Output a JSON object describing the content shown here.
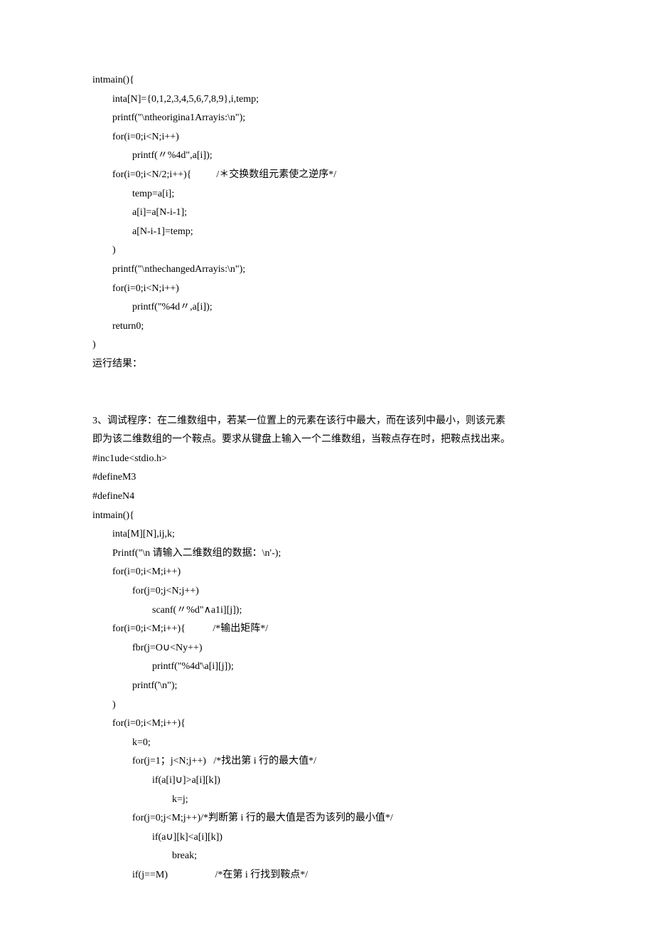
{
  "lines": [
    "intmain(){",
    "        inta[N]={0,1,2,3,4,5,6,7,8,9},i,temp;",
    "        printf(\"\\ntheorigina1Arrayis:\\n\");",
    "        for(i=0;i<N;i++)",
    "                printf(〃%4d\",a[i]);",
    "        for(i=0;i<N/2;i++){          /＊交换数组元素使之逆序*/",
    "                temp=a[i];",
    "                a[i]=a[N-i-1];",
    "                a[N-i-1]=temp;",
    "        )",
    "        printf(\"\\nthechangedArrayis:\\n\");",
    "        for(i=0;i<N;i++)",
    "                printf(\"%4d〃,a[i]);",
    "        return0;",
    ")",
    "运行结果：",
    "",
    "",
    "3、调试程序：在二维数组中，若某一位置上的元素在该行中最大，而在该列中最小，则该元素",
    "即为该二维数组的一个鞍点。要求从键盘上输入一个二维数组，当鞍点存在时，把鞍点找出来。",
    "#inc1ude<stdio.h>",
    "#defineM3",
    "#defineN4",
    "intmain(){",
    "        inta[M][N],ij,k;",
    "        Printf(\"\\n 请输入二维数组的数据：\\n'-);",
    "        for(i=0;i<M;i++)",
    "                for(j=0;j<N;j++)",
    "                        scanf(〃%d\"∧a1i][j]);",
    "        for(i=0;i<M;i++){           /*输出矩阵*/",
    "                fbr(j=O∪<Ny++)",
    "                        printf(\"%4d'\\a[i][j]);",
    "                printf('\\n\");",
    "        )",
    "        for(i=0;i<M;i++){",
    "                k=0;",
    "                for(j=1；j<N;j++)   /*找出第 i 行的最大值*/",
    "                        if(a[i]∪]>a[i][k])",
    "                                k=j;",
    "                for(j=0;j<M;j++)/*判断第 i 行的最大值是否为该列的最小值*/",
    "                        if(a∪][k]<a[i][k])",
    "                                break;",
    "                if(j==M)                   /*在第 i 行找到鞍点*/"
  ]
}
